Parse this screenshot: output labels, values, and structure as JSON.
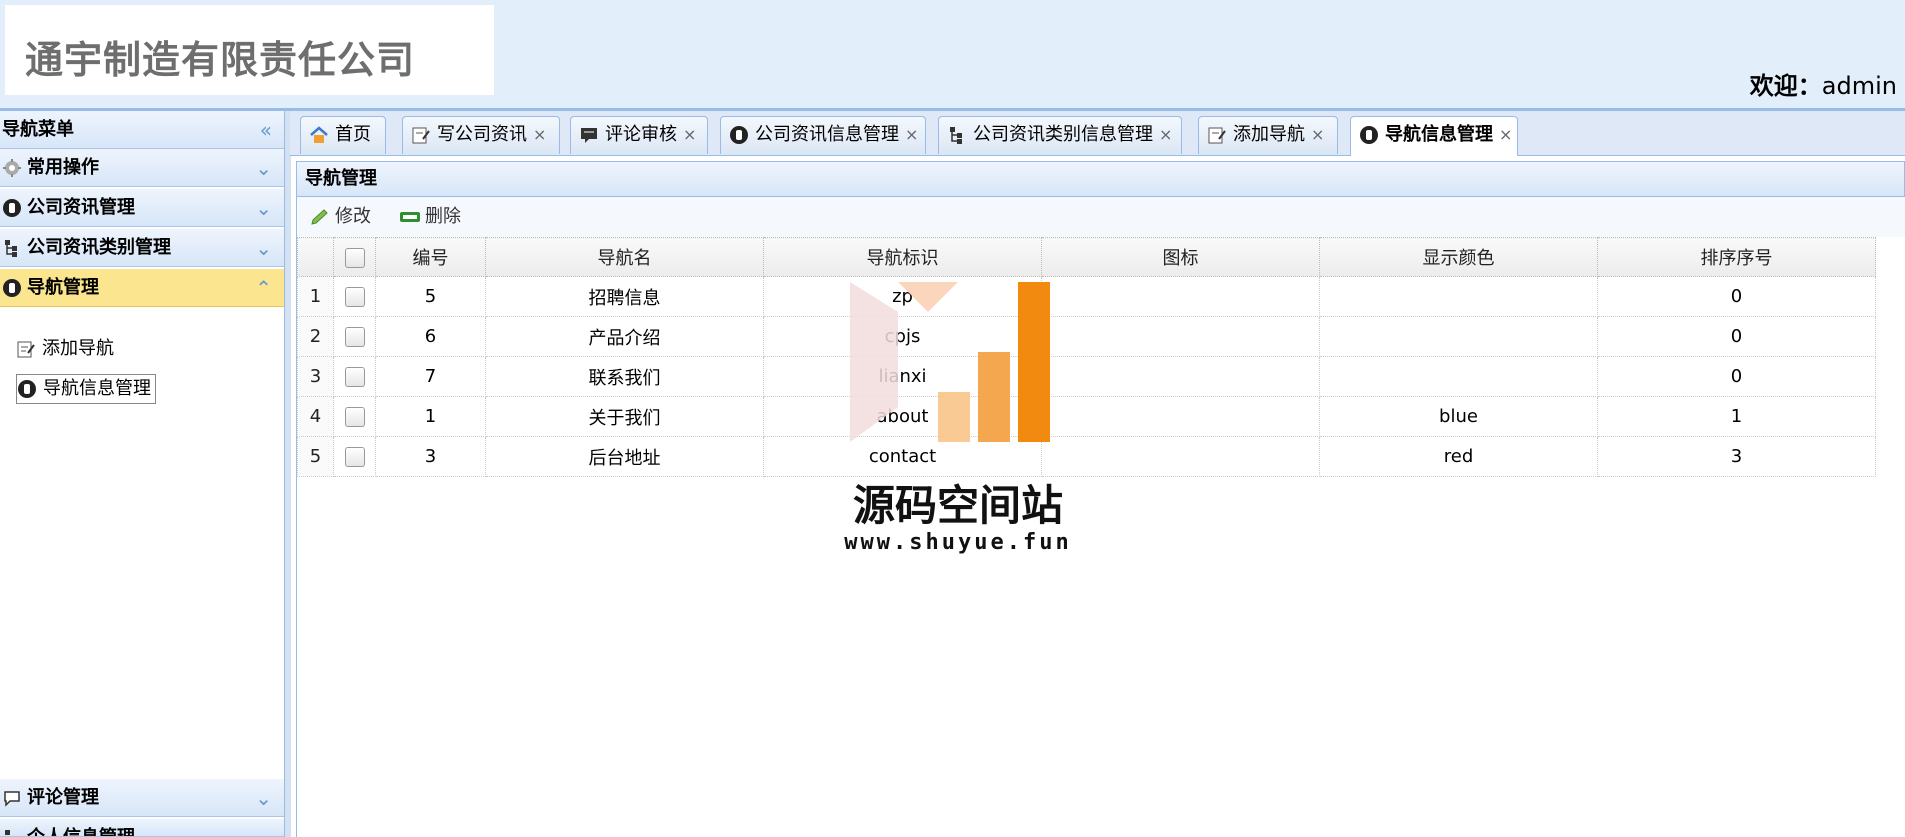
{
  "header": {
    "company": "通宇制造有限责任公司",
    "welcome_label": "欢迎：",
    "user": "admin"
  },
  "sidebar": {
    "title": "导航菜单",
    "collapse_glyph": "«",
    "sections": [
      {
        "label": "常用操作",
        "icon": "gear-icon"
      },
      {
        "label": "公司资讯管理",
        "icon": "circle-b-icon"
      },
      {
        "label": "公司资讯类别管理",
        "icon": "tree-icon"
      },
      {
        "label": "导航管理",
        "icon": "circle-b-icon",
        "active": true
      }
    ],
    "sub_items": [
      {
        "label": "添加导航",
        "icon": "edit-icon"
      },
      {
        "label": "导航信息管理",
        "icon": "circle-b-icon",
        "selected": true
      }
    ],
    "bottom_sections": [
      {
        "label": "评论管理",
        "icon": "comment-icon"
      },
      {
        "label": "个人信息管理",
        "icon": "tree-icon"
      }
    ]
  },
  "tabs": [
    {
      "label": "首页",
      "icon": "home-icon",
      "closable": false
    },
    {
      "label": "写公司资讯",
      "icon": "edit-icon",
      "closable": true
    },
    {
      "label": "评论审核",
      "icon": "comment-icon",
      "closable": true
    },
    {
      "label": "公司资讯信息管理",
      "icon": "circle-b-icon",
      "closable": true
    },
    {
      "label": "公司资讯类别信息管理",
      "icon": "tree-icon",
      "closable": true
    },
    {
      "label": "添加导航",
      "icon": "edit-icon",
      "closable": true
    },
    {
      "label": "导航信息管理",
      "icon": "circle-b-icon",
      "closable": true,
      "active": true
    }
  ],
  "panel": {
    "title": "导航管理",
    "toolbar": {
      "edit": "修改",
      "delete": "删除"
    }
  },
  "table": {
    "columns": [
      "编号",
      "导航名",
      "导航标识",
      "图标",
      "显示颜色",
      "排序序号"
    ],
    "rows": [
      {
        "n": "1",
        "id": "5",
        "name": "招聘信息",
        "key": "zp",
        "icon": "",
        "color": "",
        "order": "0"
      },
      {
        "n": "2",
        "id": "6",
        "name": "产品介绍",
        "key": "cpjs",
        "icon": "",
        "color": "",
        "order": "0"
      },
      {
        "n": "3",
        "id": "7",
        "name": "联系我们",
        "key": "lianxi",
        "icon": "",
        "color": "",
        "order": "0"
      },
      {
        "n": "4",
        "id": "1",
        "name": "关于我们",
        "key": "about",
        "icon": "",
        "color": "blue",
        "order": "1"
      },
      {
        "n": "5",
        "id": "3",
        "name": "后台地址",
        "key": "contact",
        "icon": "",
        "color": "red",
        "order": "3"
      }
    ]
  },
  "watermark": {
    "title": "源码空间站",
    "url": "www.shuyue.fun"
  }
}
